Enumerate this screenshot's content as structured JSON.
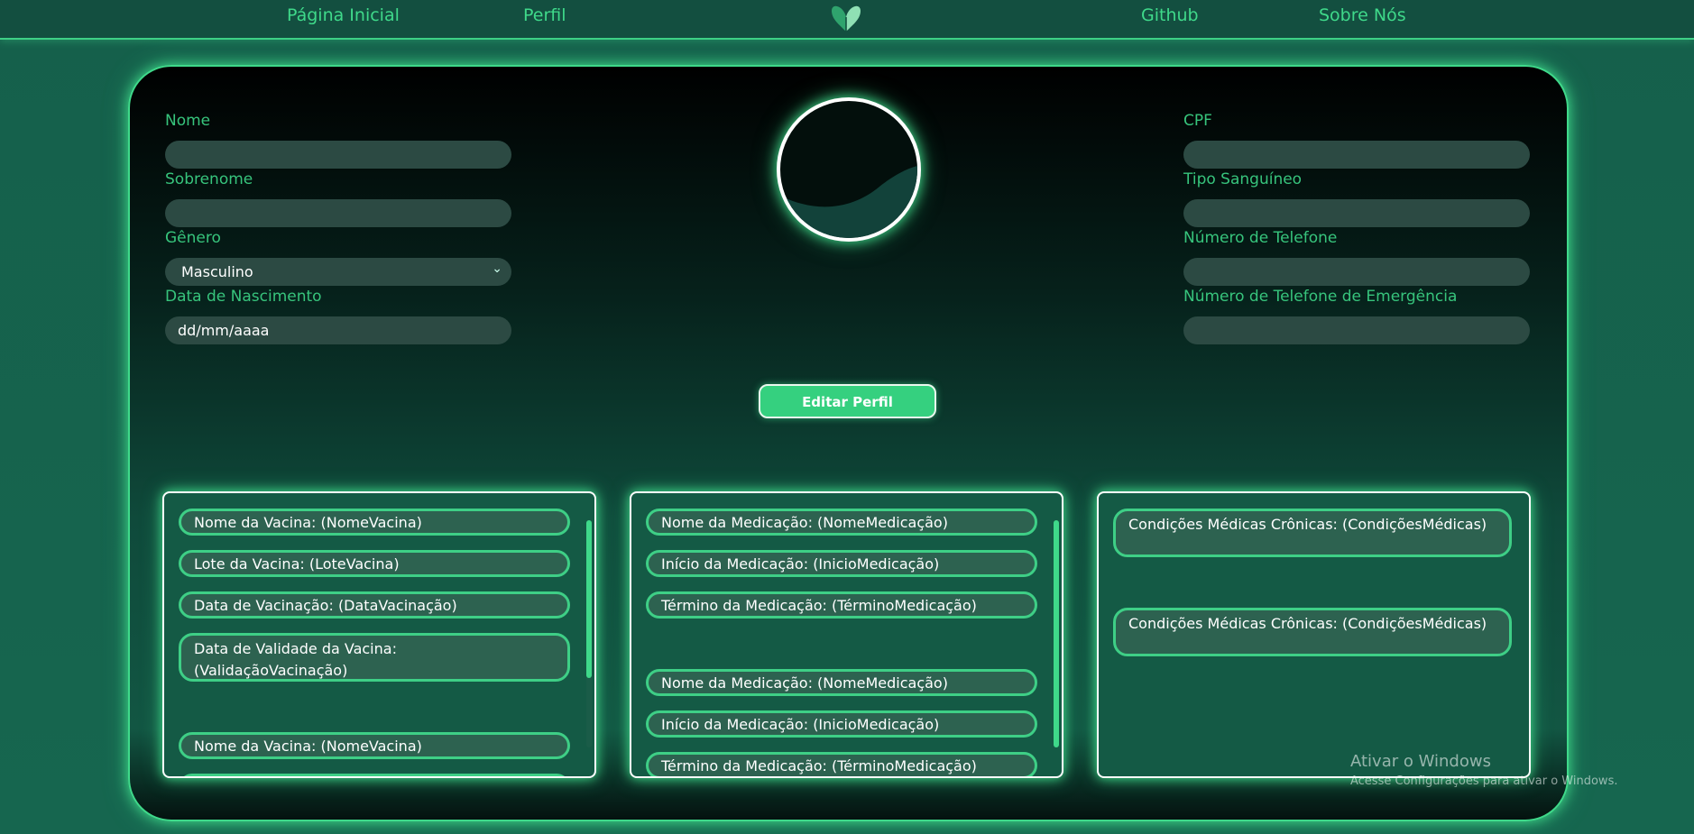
{
  "nav": {
    "home": "Página Inicial",
    "profile": "Perfil",
    "github": "Github",
    "about": "Sobre Nós",
    "logo_icon": "heart-leaf-logo"
  },
  "form": {
    "nome_label": "Nome",
    "sobrenome_label": "Sobrenome",
    "genero_label": "Gênero",
    "genero_value": "Masculino",
    "nascimento_label": "Data de Nascimento",
    "nascimento_placeholder": "dd/mm/aaaa",
    "cpf_label": "CPF",
    "tipo_sanguineo_label": "Tipo Sanguíneo",
    "telefone_label": "Número de Telefone",
    "telefone_emergencia_label": "Número de Telefone de Emergência"
  },
  "edit_button": "Editar Perfil",
  "vaccines": [
    {
      "text": "Nome da Vacina: (NomeVacina)"
    },
    {
      "text": "Lote da Vacina: (LoteVacina)"
    },
    {
      "text": "Data de Vacinação: (DataVacinação)"
    },
    {
      "text": "Data de Validade da Vacina: (ValidaçãoVacinação)"
    },
    {
      "text": "Nome da Vacina: (NomeVacina)"
    }
  ],
  "medications": [
    {
      "text": "Nome da Medicação: (NomeMedicação)"
    },
    {
      "text": "Início da Medicação: (InicioMedicação)"
    },
    {
      "text": "Término da Medicação: (TérminoMedicação)"
    },
    {
      "text": "Nome da Medicação: (NomeMedicação)"
    },
    {
      "text": "Início da Medicação: (InicioMedicação)"
    },
    {
      "text": "Término da Medicação: (TérminoMedicação)"
    }
  ],
  "conditions": [
    {
      "text": "Condições Médicas Crônicas: (CondiçõesMédicas)"
    },
    {
      "text": "Condições Médicas Crônicas: (CondiçõesMédicas)"
    }
  ],
  "watermark": {
    "title": "Ativar o Windows",
    "subtitle": "Acesse Configurações para ativar o Windows."
  },
  "colors": {
    "accent": "#3fd98a",
    "background": "#15604b",
    "pill_fill": "#2d6250"
  }
}
